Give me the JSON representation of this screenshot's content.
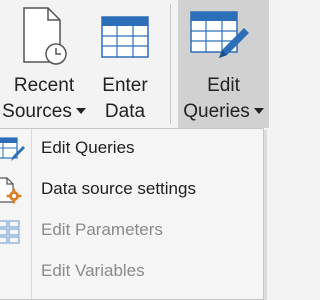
{
  "ribbon": {
    "recent_sources": {
      "line1": "Recent",
      "line2": "Sources",
      "icon": "document-clock-icon"
    },
    "enter_data": {
      "line1": "Enter",
      "line2": "Data",
      "icon": "table-icon"
    },
    "edit_queries": {
      "line1": "Edit",
      "line2": "Queries",
      "icon": "table-pencil-icon"
    }
  },
  "menu": {
    "items": [
      {
        "label": "Edit Queries",
        "enabled": true,
        "icon": "table-pencil-icon"
      },
      {
        "label": "Data source settings",
        "enabled": true,
        "icon": "document-gear-icon"
      },
      {
        "label": "Edit Parameters",
        "enabled": false,
        "icon": "parameters-icon"
      },
      {
        "label": "Edit Variables",
        "enabled": false,
        "icon": ""
      }
    ]
  },
  "colors": {
    "table_blue": "#2c6fb8",
    "selected_button": "#d1d1d1",
    "gear_orange": "#d9822b",
    "disabled_text": "#8a8a8a"
  }
}
